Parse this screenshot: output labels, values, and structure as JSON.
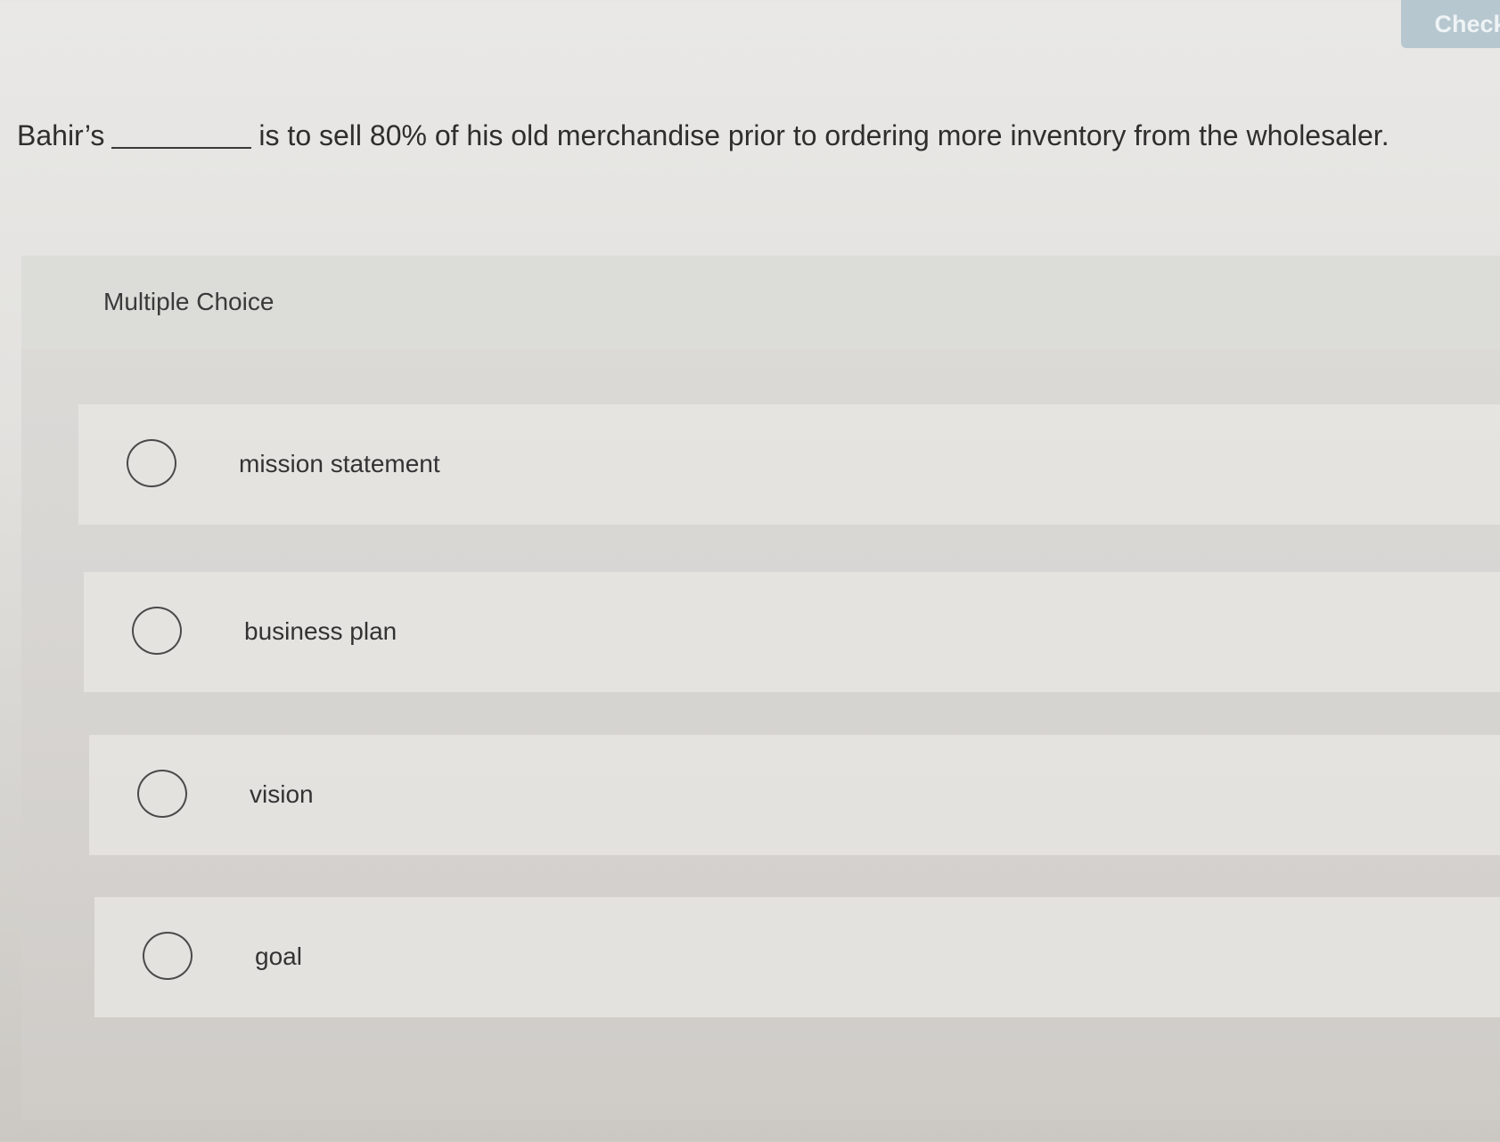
{
  "toolbar": {
    "check_label": "Check"
  },
  "question": {
    "prefix": "Bahir’s",
    "suffix": "is to sell 80% of his old merchandise prior to ordering more inventory from the wholesaler."
  },
  "multiple_choice": {
    "label": "Multiple Choice",
    "options": [
      {
        "label": "mission statement"
      },
      {
        "label": "business plan"
      },
      {
        "label": "vision"
      },
      {
        "label": "goal"
      }
    ]
  },
  "colors": {
    "check_button_bg": "#b7c7cf",
    "page_bg": "#e6e5e2",
    "text": "#2e2e2e"
  }
}
